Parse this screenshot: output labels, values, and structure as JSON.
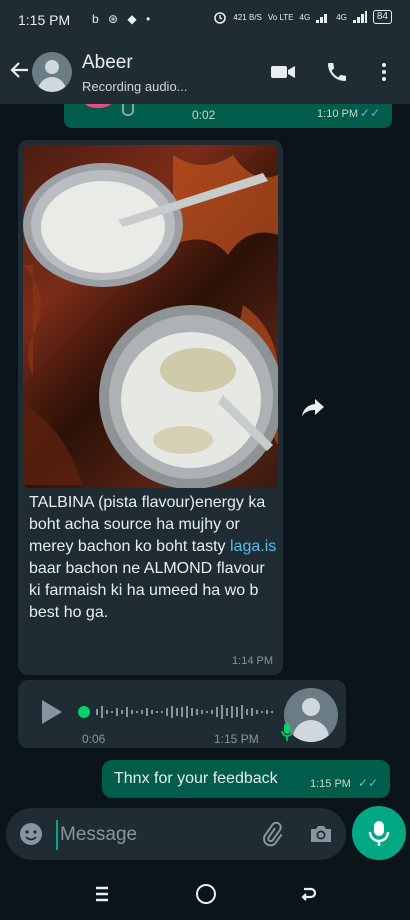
{
  "status_bar": {
    "time": "1:15 PM",
    "left_icons": "b ⊛ ◆ •",
    "network_info": "421 B/S",
    "vo_lte": "Vo LTE",
    "network_type": "4G",
    "network_type_2": "4G",
    "battery": "84"
  },
  "header": {
    "contact_name": "Abeer",
    "contact_status": "Recording audio...",
    "icons": [
      "back-arrow-icon",
      "video-call-icon",
      "voice-call-icon",
      "more-options-icon"
    ]
  },
  "messages": {
    "top_audio": {
      "duration": "0:02",
      "time": "1:10 PM",
      "ticks": "✓✓"
    },
    "image_message": {
      "caption_part1": "TALBINA (pista flavour)energy ka boht acha source ha mujhy or merey bachon ko boht tasty ",
      "caption_link": "laga.is",
      "caption_part2": " baar bachon ne ALMOND flavour ki farmaish ki ha umeed ha wo b best ho ga.",
      "time": "1:14 PM"
    },
    "audio_message": {
      "duration": "0:06",
      "time": "1:15 PM"
    },
    "outgoing_text": {
      "text": "Thnx for your feedback",
      "time": "1:15 PM",
      "ticks": "✓✓"
    }
  },
  "input_bar": {
    "placeholder": "Message"
  },
  "colors": {
    "background": "#0b141a",
    "header": "#1f2c34",
    "outgoing_bubble": "#005c4b",
    "incoming_bubble": "#1f2c34",
    "accent": "#00a884",
    "read_ticks": "#53bdeb"
  }
}
